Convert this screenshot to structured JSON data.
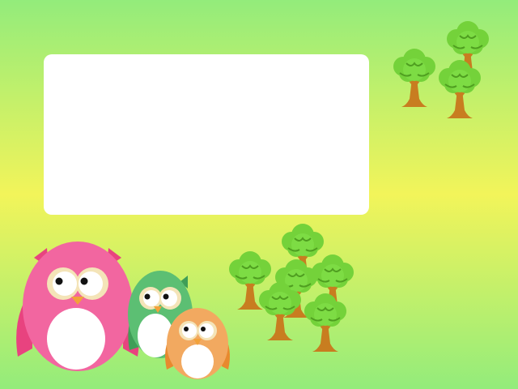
{
  "scene": {
    "background": {
      "top_color": "#93ec7b",
      "middle_color": "#f2f45a",
      "bottom_color": "#93ec7b"
    },
    "panel": {
      "text": "",
      "color": "#ffffff"
    },
    "owls": [
      {
        "name": "pink-owl",
        "body_color": "#f266a0",
        "wing_color": "#e8437f"
      },
      {
        "name": "green-owl",
        "body_color": "#5cbf73",
        "wing_color": "#3f9e57"
      },
      {
        "name": "orange-owl",
        "body_color": "#f2a960",
        "wing_color": "#e8892e"
      }
    ],
    "trees": {
      "foliage_color": "#74d23a",
      "foliage_dark_color": "#4f9e20",
      "trunk_color": "#c87d20",
      "top_cluster_count": 3,
      "bottom_cluster_count": 7
    }
  }
}
